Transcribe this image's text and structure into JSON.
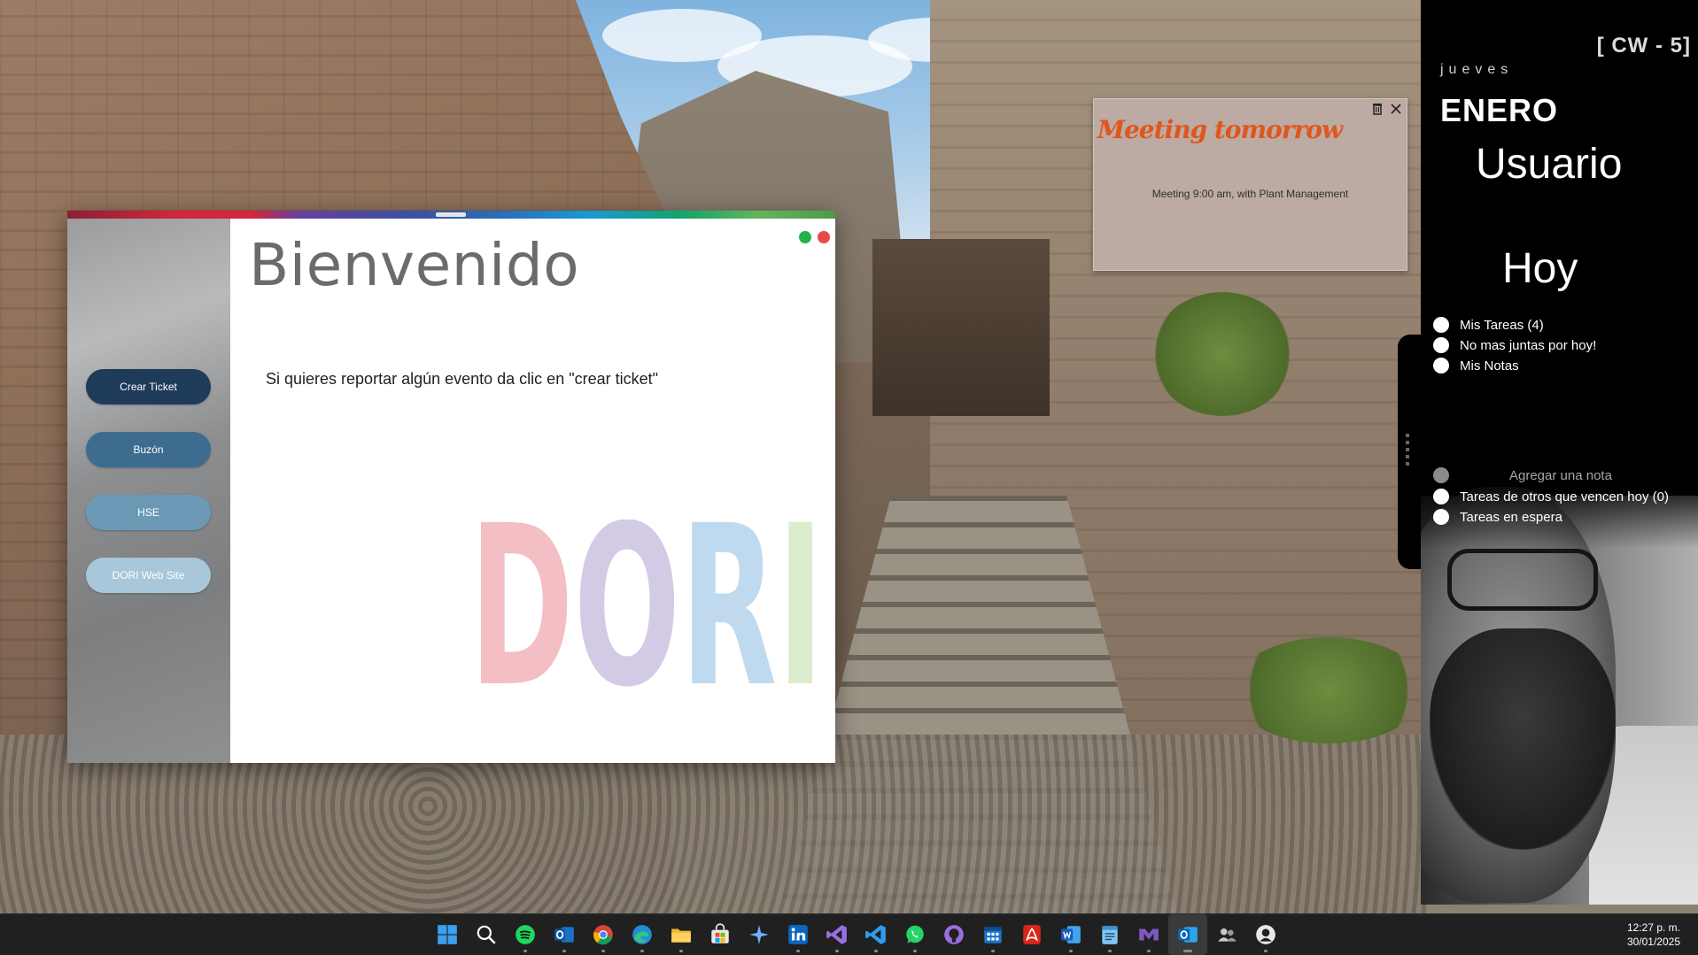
{
  "app_window": {
    "title": "Bienvenido",
    "message": "Si quieres reportar algún evento da clic en \"crear ticket\"",
    "buttons": [
      "Crear Ticket",
      "Buzón",
      "HSE",
      "DORI Web Site"
    ],
    "logo_text": "DORI",
    "logo_colors": [
      "#f2b8be",
      "#cfc6e3",
      "#b9d6ee",
      "#d9ebc9"
    ]
  },
  "sticky_note": {
    "title": "Meeting tomorrow",
    "body": "Meeting 9:00 am,  with Plant Management",
    "icons": [
      "trash-icon",
      "close-icon"
    ]
  },
  "side_panel": {
    "week": "[ CW - 5]",
    "weekday": "jueves",
    "month": "ENERO",
    "user": "Usuario",
    "today": "Hoy",
    "tasks_top": [
      "Mis Tareas (4)",
      "No mas juntas por hoy!",
      "Mis Notas"
    ],
    "add_note": "Agregar una nota",
    "tasks_bottom": [
      "Tareas de otros que vencen hoy (0)",
      "Tareas en espera"
    ]
  },
  "taskbar": {
    "icons": [
      "windows-start-icon",
      "search-icon",
      "spotify-icon",
      "outlook-icon",
      "chrome-icon",
      "edge-icon",
      "file-explorer-icon",
      "microsoft-store-icon",
      "copilot-icon",
      "linkedin-icon",
      "visual-studio-icon",
      "vscode-icon",
      "whatsapp-icon",
      "github-icon",
      "calendar-app-icon",
      "acrobat-icon",
      "word-icon",
      "notepad-icon",
      "visual-studio-purple-icon",
      "outlook-new-icon",
      "people-icon",
      "github-avatar-icon"
    ],
    "time": "12:27 p. m.",
    "date": "30/01/2025"
  },
  "colors": {
    "accent_dark_blue": "#1e3b5a",
    "note_title": "#e0561c",
    "panel_bg": "#000000",
    "taskbar_bg": "#202020"
  }
}
